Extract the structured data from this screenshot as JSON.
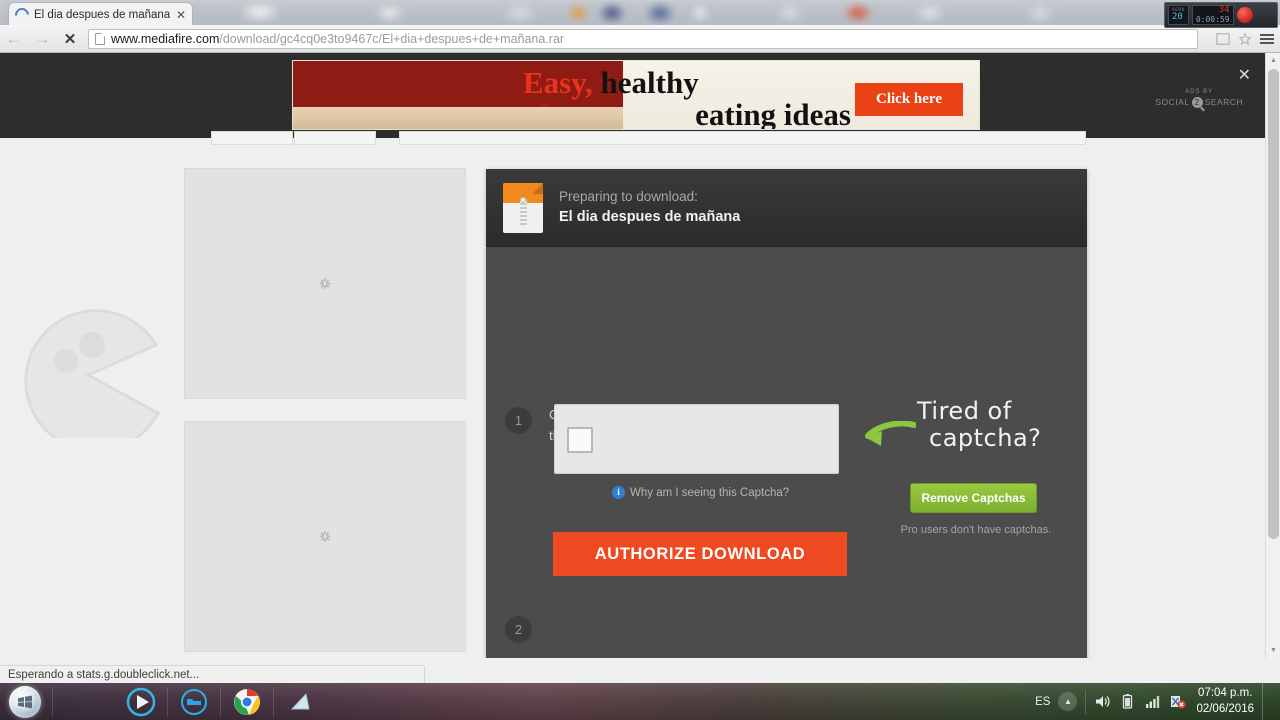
{
  "browser": {
    "tab": {
      "title": "El dia despues de mañana",
      "close_label": "✕",
      "favicon": "loading-spinner-icon"
    },
    "nav": {
      "back": "←",
      "forward": "→",
      "stop": "✕"
    },
    "url": {
      "host": "www.mediafire.com",
      "path": "/download/gc4cq0e3to9467c/El+dia+despues+de+mañana.rar"
    },
    "status_text": "Esperando a stats.g.doubleclick.net..."
  },
  "ad": {
    "headline_1_highlight": "Easy,",
    "headline_1_rest": " healthy",
    "headline_2": "eating ideas",
    "cta": "Click here",
    "ads_by_line1": "ADS BY",
    "ads_by_left": "SOCIAL",
    "ads_by_badge": "2",
    "ads_by_right": "SEARCH",
    "close": "✕"
  },
  "download": {
    "preparing_label": "Preparing to download:",
    "file_name": "El dia despues de mañana",
    "step1_number": "1",
    "step1_line1": "Complete the task below, and then click",
    "step1_line2": "the Authorize button to download.",
    "step2_number": "2",
    "authorize_label": "AUTHORIZE DOWNLOAD",
    "why_captcha": "Why am I seeing this Captcha?",
    "info_glyph": "i"
  },
  "promo": {
    "title_line1": "Tired of",
    "title_line2": "captcha?",
    "button": "Remove Captchas",
    "note": "Pro users don't have captchas."
  },
  "taskbar": {
    "language": "ES",
    "time": "07:04 p.m.",
    "date": "02/06/2016",
    "tray_up": "▲",
    "apps": [
      "start-orb",
      "media-player",
      "app-blue",
      "google-chrome",
      "app-teal"
    ]
  },
  "recorder": {
    "label": "AERO",
    "fps": "20",
    "counter": "34",
    "elapsed": "0:00:59"
  },
  "colors": {
    "accent_orange": "#ef4922",
    "promo_green": "#8fc136",
    "panel_bg": "#4c4c4c",
    "panel_head": "#2f2f2f",
    "ad_red": "#ea4215"
  }
}
